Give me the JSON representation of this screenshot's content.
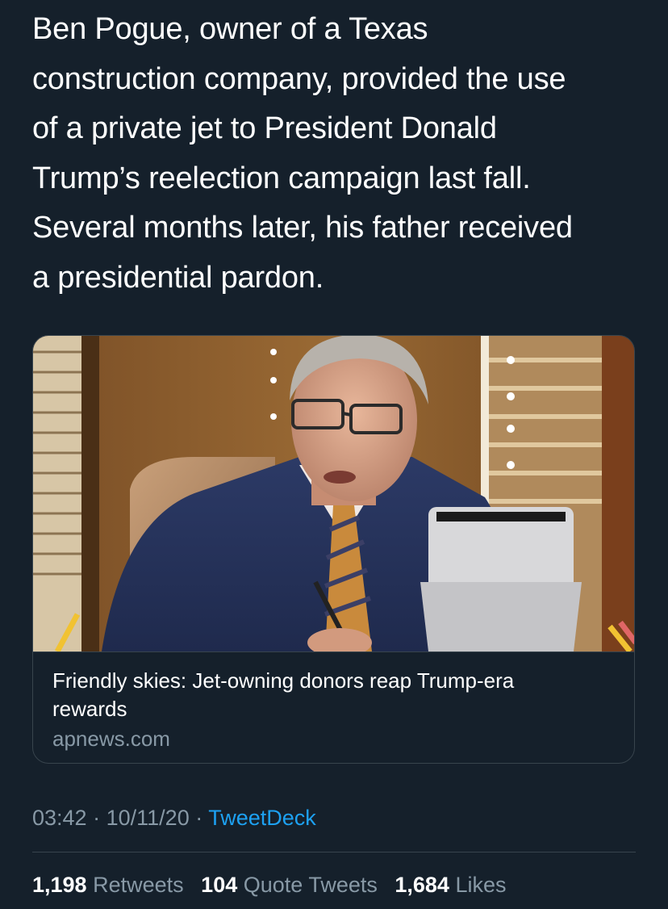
{
  "tweet": {
    "text_lines": [
      "Ben Pogue, owner of a Texas",
      "construction company, provided the use",
      "of a private jet to President Donald",
      "Trump’s reelection campaign last fall.",
      "Several months later, his father received",
      "a presidential pardon."
    ]
  },
  "card": {
    "image_icon": "photo-of-man-in-suit-at-desk",
    "title": "Friendly skies: Jet-owning donors reap Trump-era rewards",
    "domain": "apnews.com"
  },
  "meta": {
    "time": "03:42",
    "separator": "·",
    "date": "10/11/20",
    "source": "TweetDeck"
  },
  "stats": {
    "retweets_count": "1,198",
    "retweets_label": "Retweets",
    "quote_count": "104",
    "quote_label": "Quote Tweets",
    "likes_count": "1,684",
    "likes_label": "Likes"
  },
  "colors": {
    "background": "#15202b",
    "text": "#ffffff",
    "secondary": "#8899a6",
    "link": "#1da1f2",
    "border": "#38444d"
  }
}
